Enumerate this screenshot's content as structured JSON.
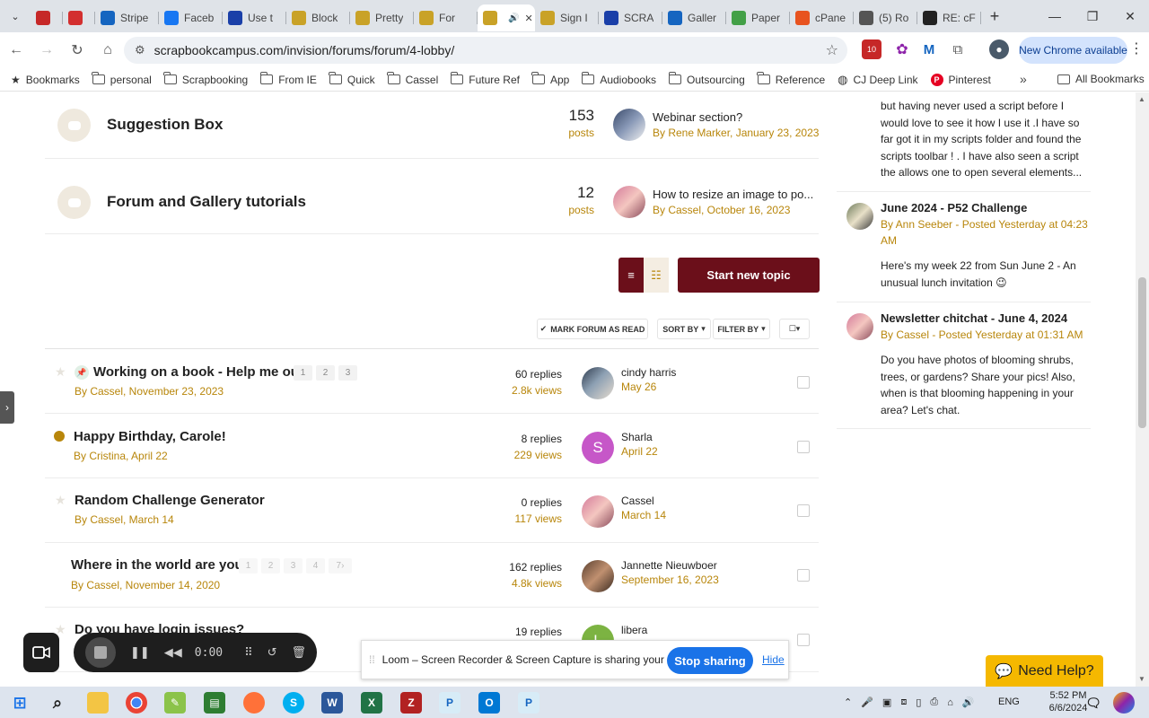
{
  "browser": {
    "tabs": [
      {
        "title": "",
        "icon": "record-icon",
        "color": "#c62828"
      },
      {
        "title": "",
        "icon": "grid-icon",
        "color": "#d32f2f"
      },
      {
        "title": "Stripe",
        "icon": "shield-icon",
        "color": "#1565c0"
      },
      {
        "title": "Faceb",
        "icon": "facebook-icon",
        "color": "#1877f2"
      },
      {
        "title": "Use t",
        "icon": "arrow-icon",
        "color": "#1a3fa8"
      },
      {
        "title": "Block",
        "icon": "crest-icon",
        "color": "#c9a227"
      },
      {
        "title": "Pretty",
        "icon": "crest-icon",
        "color": "#c9a227"
      },
      {
        "title": "For",
        "icon": "crest-icon",
        "color": "#c9a227"
      },
      {
        "title": "",
        "icon": "crest-icon",
        "color": "#c9a227",
        "active": true
      },
      {
        "title": "Sign I",
        "icon": "crest-icon",
        "color": "#c9a227"
      },
      {
        "title": "SCRA",
        "icon": "arrow-icon",
        "color": "#1a3fa8"
      },
      {
        "title": "Galler",
        "icon": "check-icon",
        "color": "#1565c0"
      },
      {
        "title": "Paper",
        "icon": "leaf-icon",
        "color": "#43a047"
      },
      {
        "title": "cPane",
        "icon": "cpanel-icon",
        "color": "#e8531f"
      },
      {
        "title": "(5) Ro",
        "icon": "wings-icon",
        "color": "#555555"
      },
      {
        "title": "RE: cF",
        "icon": "plus-square-icon",
        "color": "#222222"
      }
    ],
    "url": "scrapbookcampus.com/invision/forums/forum/4-lobby/",
    "update_label": "New Chrome available",
    "extension_badge": "10",
    "bookmarks": [
      {
        "label": "Bookmarks",
        "icon": "star-icon"
      },
      {
        "label": "personal",
        "icon": "folder-icon"
      },
      {
        "label": "Scrapbooking",
        "icon": "folder-icon"
      },
      {
        "label": "From IE",
        "icon": "folder-icon"
      },
      {
        "label": "Quick",
        "icon": "folder-icon"
      },
      {
        "label": "Cassel",
        "icon": "folder-icon"
      },
      {
        "label": "Future Ref",
        "icon": "folder-icon"
      },
      {
        "label": "App",
        "icon": "folder-icon"
      },
      {
        "label": "Audiobooks",
        "icon": "folder-icon"
      },
      {
        "label": "Outsourcing",
        "icon": "folder-icon"
      },
      {
        "label": "Reference",
        "icon": "folder-icon"
      },
      {
        "label": "CJ Deep Link",
        "icon": "globe-icon"
      },
      {
        "label": "Pinterest",
        "icon": "pinterest-icon"
      }
    ],
    "all_bookmarks_label": "All Bookmarks"
  },
  "forums": [
    {
      "title": "Suggestion Box",
      "count": "153",
      "count_label": "posts",
      "last_title": "Webinar section?",
      "last_by": "By Rene Marker, January 23, 2023"
    },
    {
      "title": "Forum and Gallery tutorials",
      "count": "12",
      "count_label": "posts",
      "last_title": "How to resize an image to po...",
      "last_by": "By Cassel, October 16, 2023"
    }
  ],
  "actions": {
    "start_topic": "Start new topic",
    "mark_read": "MARK FORUM AS READ",
    "sort_by": "SORT BY",
    "filter_by": "FILTER BY"
  },
  "topics": [
    {
      "title": "Working on a book - Help me out!",
      "by": "By Cassel, November 23, 2023",
      "pages": [
        "1",
        "2",
        "3"
      ],
      "replies": "60 replies",
      "views": "2.8k views",
      "last_name": "cindy harris",
      "last_date": "May 26",
      "pinned": true
    },
    {
      "title": "Happy Birthday, Carole!",
      "by": "By Cristina, April 22",
      "pages": [],
      "replies": "8 replies",
      "views": "229 views",
      "last_name": "Sharla",
      "last_date": "April 22",
      "avatar_letter": "S",
      "unread": true
    },
    {
      "title": "Random Challenge Generator",
      "by": "By Cassel, March 14",
      "pages": [],
      "replies": "0 replies",
      "views": "117 views",
      "last_name": "Cassel",
      "last_date": "March 14"
    },
    {
      "title": "Where in the world are you?",
      "by": "By Cassel, November 14, 2020",
      "pages": [
        "1",
        "2",
        "3",
        "4",
        "7"
      ],
      "replies": "162 replies",
      "views": "4.8k views",
      "last_name": "Jannette Nieuwboer",
      "last_date": "September 16, 2023"
    },
    {
      "title": "Do you have login issues?",
      "by": "",
      "pages": [],
      "replies": "19 replies",
      "views": "",
      "last_name": "libera",
      "last_date": "",
      "avatar_letter": "L"
    }
  ],
  "sidebar": [
    {
      "title": "",
      "by": "",
      "text": "but having never used a script before I would love to see it how I use it .I have so far got it in my scripts folder and found the scripts toolbar ! . I have also seen a script the allows one to open several elements..."
    },
    {
      "title": "June 2024 - P52 Challenge",
      "by": "By Ann Seeber - Posted Yesterday at 04:23 AM",
      "text": "Here's my week 22 from Sun June 2 - An unusual lunch invitation 😉"
    },
    {
      "title": "Newsletter chitchat - June 4, 2024",
      "by": "By Cassel - Posted Yesterday at 01:31 AM",
      "text": "Do you have photos of blooming shrubs, trees, or gardens? Share your pics! Also, when is that blooming happening in your area? Let's chat."
    }
  ],
  "loom": {
    "time": "0:00",
    "share_message": "Loom – Screen Recorder & Screen Capture is sharing your screen.",
    "stop_label": "Stop sharing",
    "hide_label": "Hide"
  },
  "help": {
    "label": "Need Help?"
  },
  "taskbar": {
    "lang": "ENG",
    "time": "5:52 PM",
    "date": "6/6/2024"
  }
}
